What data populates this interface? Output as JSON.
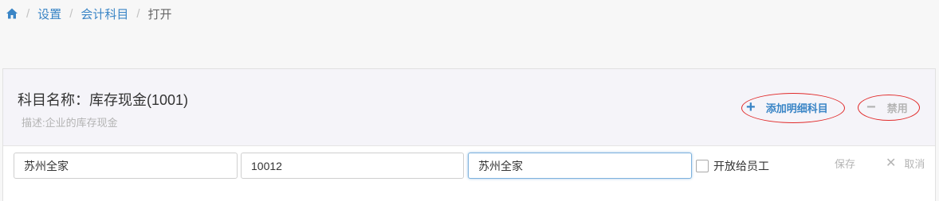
{
  "breadcrumb": {
    "home_icon": "home-icon",
    "items": [
      "设置",
      "会计科目"
    ],
    "current": "打开",
    "separator": "/"
  },
  "subject": {
    "title": "科目名称：库存现金(1001)",
    "description": "描述:企业的库存现金"
  },
  "actions": {
    "add_detail_label": "添加明细科目",
    "disable_label": "禁用"
  },
  "detail_row": {
    "name_value": "苏州全家",
    "code_value": "10012",
    "alias_value": "苏州全家",
    "open_to_staff_label": "开放给员工",
    "open_to_staff_checked": false,
    "save_label": "保存",
    "cancel_label": "取消"
  },
  "colors": {
    "link": "#3a85c6",
    "annotation": "#e12a2a",
    "disabled": "#b4b4b4"
  }
}
